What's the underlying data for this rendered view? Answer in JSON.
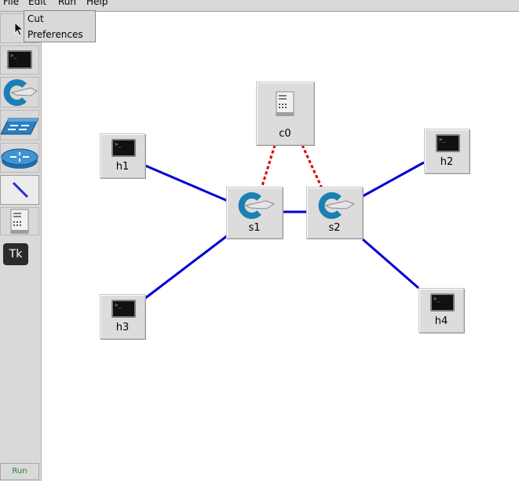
{
  "menubar": {
    "items": [
      "File",
      "Edit",
      "Run",
      "Help"
    ]
  },
  "dropdown": {
    "items": [
      "Cut",
      "Preferences"
    ]
  },
  "toolbar": {
    "tools": [
      "select",
      "host",
      "switch",
      "legacy-switch",
      "router",
      "link",
      "controller"
    ],
    "tk_label": "Tk",
    "run_label": "Run"
  },
  "nodes": {
    "c0": "c0",
    "h1": "h1",
    "h2": "h2",
    "h3": "h3",
    "h4": "h4",
    "s1": "s1",
    "s2": "s2"
  },
  "colors": {
    "link": "#0000d0",
    "controller_link": "#dd0000",
    "switch_blue": "#1a7fb5"
  }
}
